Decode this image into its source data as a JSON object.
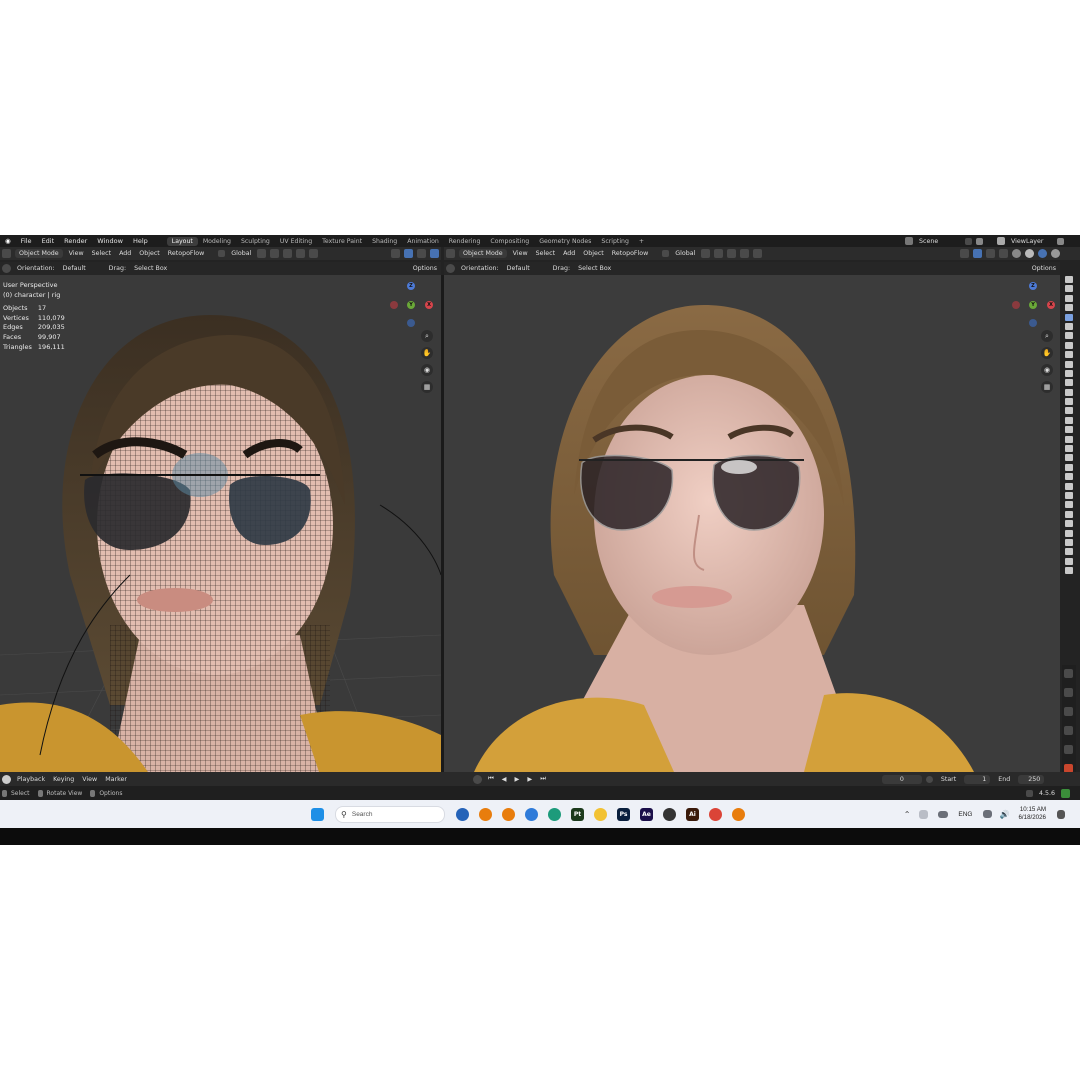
{
  "menus": [
    "File",
    "Edit",
    "Render",
    "Window",
    "Help"
  ],
  "workspaces": [
    "Layout",
    "Modeling",
    "Sculpting",
    "UV Editing",
    "Texture Paint",
    "Shading",
    "Animation",
    "Rendering",
    "Compositing",
    "Geometry Nodes",
    "Scripting"
  ],
  "active_workspace": "Layout",
  "add_workspace": "+",
  "scene": "Scene",
  "view_layer": "ViewLayer",
  "left_view": {
    "mode": "Object Mode",
    "menu": [
      "View",
      "Select",
      "Add",
      "Object"
    ],
    "addon": "RetopoFlow",
    "transform": "Global",
    "orientation_label": "Orientation:",
    "orientation": "Default",
    "drag_label": "Drag:",
    "drag": "Select Box",
    "options": "Options",
    "perspective": "User Perspective",
    "collection": "(0) character | rig",
    "stats": [
      {
        "label": "Objects",
        "value": "17"
      },
      {
        "label": "Vertices",
        "value": "110,079"
      },
      {
        "label": "Edges",
        "value": "209,035"
      },
      {
        "label": "Faces",
        "value": "99,907"
      },
      {
        "label": "Triangles",
        "value": "196,111"
      }
    ]
  },
  "right_view": {
    "mode": "Object Mode",
    "menu": [
      "View",
      "Select",
      "Add",
      "Object"
    ],
    "addon": "RetopoFlow",
    "transform": "Global",
    "orientation_label": "Orientation:",
    "orientation": "Default",
    "drag_label": "Drag:",
    "drag": "Select Box",
    "options": "Options"
  },
  "gizmo_axes": {
    "z": "Z",
    "y": "Y",
    "x": "X"
  },
  "timeline": {
    "menu": [
      "Playback",
      "Keying",
      "View",
      "Marker"
    ],
    "current_frame": "0",
    "start_label": "Start",
    "start": "1",
    "end_label": "End",
    "end": "250"
  },
  "statusbar": {
    "items": [
      "Select",
      "Rotate View",
      "Options"
    ],
    "version": "4.5.6"
  },
  "taskbar": {
    "search_placeholder": "Search",
    "apps": [
      {
        "icon": "blender-icon",
        "label": "",
        "color": "#e87d0d"
      },
      {
        "icon": "blender-icon",
        "label": "",
        "color": "#e87d0d"
      },
      {
        "icon": "store-icon",
        "label": "",
        "color": "#2f7bd9"
      },
      {
        "icon": "edge-icon",
        "label": "",
        "color": "#1d9b7b"
      },
      {
        "icon": "pt-icon",
        "label": "Pt",
        "color": "#1c3a1c"
      },
      {
        "icon": "folder-icon",
        "label": "",
        "color": "#f2c233"
      },
      {
        "icon": "ps-icon",
        "label": "Ps",
        "color": "#0a1f3d"
      },
      {
        "icon": "ae-icon",
        "label": "Ae",
        "color": "#1b0f4a"
      },
      {
        "icon": "zbrush-icon",
        "label": "",
        "color": "#333333"
      },
      {
        "icon": "ai-icon",
        "label": "Ai",
        "color": "#3a1a0a"
      },
      {
        "icon": "chrome-icon",
        "label": "",
        "color": "#db4437"
      },
      {
        "icon": "blender-icon",
        "label": "",
        "color": "#e87d0d"
      }
    ],
    "lang": "ENG",
    "time": "10:15 AM",
    "date": "6/18/2026"
  }
}
